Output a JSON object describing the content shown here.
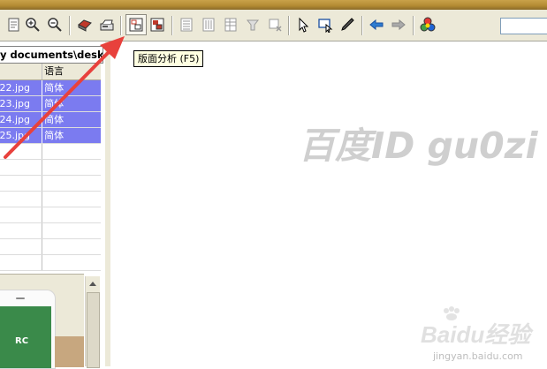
{
  "toolbar": {
    "buttons": [
      {
        "icon": "page-icon"
      },
      {
        "icon": "zoom-in-icon"
      },
      {
        "icon": "zoom-out-icon"
      },
      {
        "icon": "open-folder-icon"
      },
      {
        "icon": "scanner-icon"
      },
      {
        "icon": "layout-analysis-icon",
        "active": true
      },
      {
        "icon": "recognize-icon"
      },
      {
        "icon": "text-block-icon"
      },
      {
        "icon": "vertical-block-icon"
      },
      {
        "icon": "table-block-icon"
      },
      {
        "icon": "merge-block-icon"
      },
      {
        "icon": "delete-block-icon"
      },
      {
        "icon": "pointer-icon"
      },
      {
        "icon": "select-region-icon"
      },
      {
        "icon": "pen-icon"
      },
      {
        "icon": "arrow-left-icon"
      },
      {
        "icon": "arrow-right-icon"
      },
      {
        "icon": "colors-icon"
      }
    ]
  },
  "tooltip": {
    "text": "版面分析 (F5)"
  },
  "path_text": "y documents\\desk",
  "file_table": {
    "language_header": "语言",
    "rows": [
      {
        "name": "_22.jpg",
        "lang": "简体"
      },
      {
        "name": "_23.jpg",
        "lang": "简体"
      },
      {
        "name": "_24.jpg",
        "lang": "简体"
      },
      {
        "name": "_25.jpg",
        "lang": "简体"
      }
    ],
    "empty_rows": 8
  },
  "thumbnail": {
    "label": "RC"
  },
  "watermark": {
    "text": "百度ID gu0zi"
  },
  "baidu_logo": {
    "brand": "Baidu经验",
    "url": "jingyan.baidu.com"
  },
  "colors": {
    "selection": "#7b7bf0",
    "arrow": "#e8413c",
    "toolbar_bg": "#ece9d8"
  }
}
